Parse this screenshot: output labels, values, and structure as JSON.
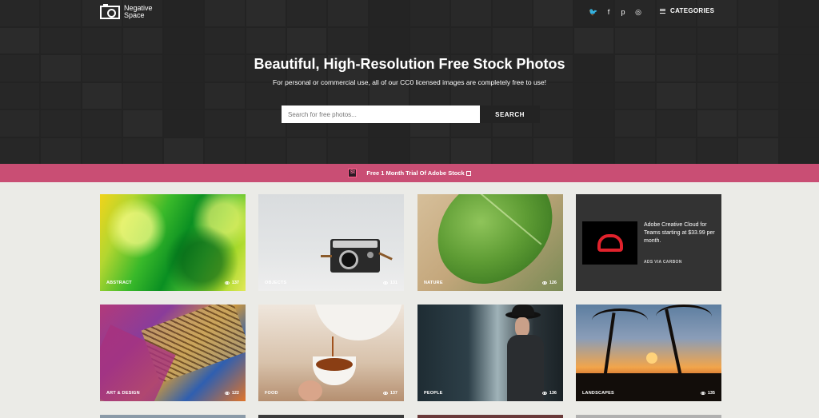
{
  "header": {
    "logo_text": "Negative Space",
    "social": [
      "twitter-icon",
      "facebook-icon",
      "pinterest-icon",
      "instagram-icon"
    ],
    "social_glyphs": [
      "🐦",
      "f",
      "p",
      "◎"
    ],
    "categories_label": "CATEGORIES"
  },
  "hero": {
    "title": "Beautiful, High-Resolution Free Stock Photos",
    "subtitle": "For personal or commercial use, all of our CC0 licensed images are completely free to use!",
    "search_placeholder": "Search for free photos...",
    "search_button": "SEARCH"
  },
  "promo": {
    "icon_text": "St",
    "text": "Free 1 Month Trial Of Adobe Stock"
  },
  "cards": [
    {
      "label": "ABSTRACT",
      "views": "137"
    },
    {
      "label": "OBJECTS",
      "views": "131"
    },
    {
      "label": "NATURE",
      "views": "126"
    },
    {
      "label": "ART & DESIGN",
      "views": "122"
    },
    {
      "label": "FOOD",
      "views": "137"
    },
    {
      "label": "PEOPLE",
      "views": "136"
    },
    {
      "label": "LANDSCAPES",
      "views": "135"
    }
  ],
  "ad": {
    "text": "Adobe Creative Cloud for Teams starting at $33.99 per month.",
    "via": "ADS VIA CARBON"
  },
  "colors": {
    "promo": "#c94e74",
    "hero": "#2b2b2b",
    "background": "#ebebe7"
  }
}
